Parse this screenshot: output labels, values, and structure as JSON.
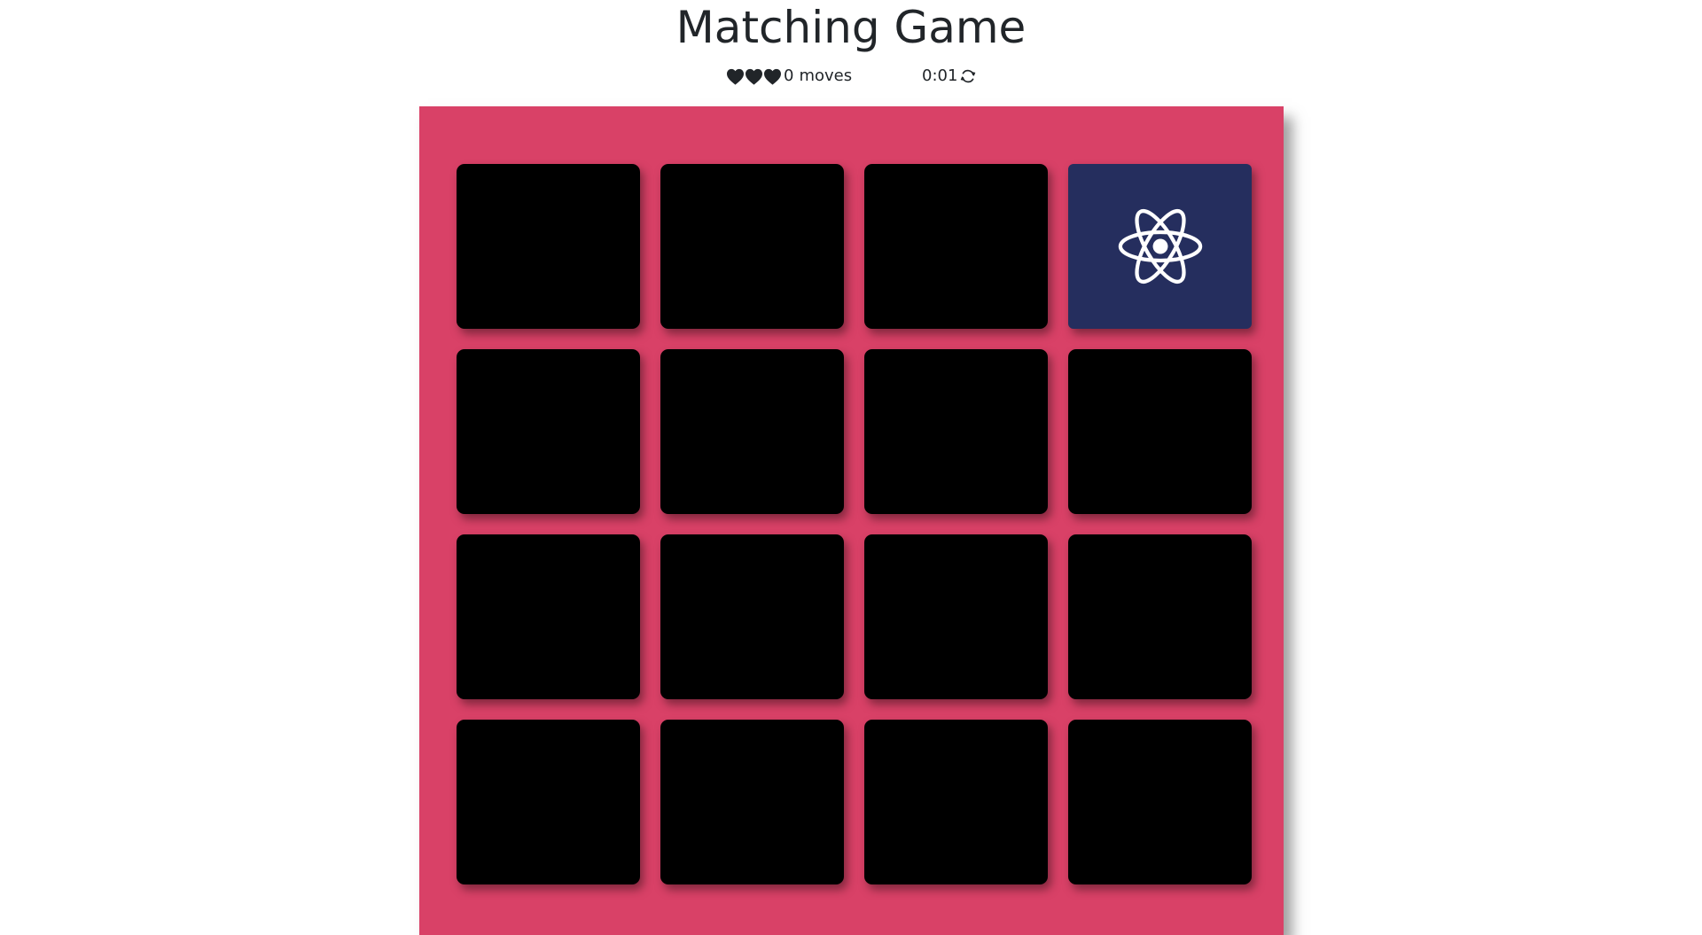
{
  "game": {
    "title": "Matching Game",
    "moves_count": "0",
    "moves_label": "moves",
    "timer": "0:01",
    "stars_total": 3,
    "stars_filled": 3,
    "icons": {
      "stars": "heart-icon",
      "restart": "refresh-icon",
      "open_card": "react-atom-icon"
    },
    "colors": {
      "board": "#d94167",
      "card_back": "#000000",
      "card_open": "#252e5e",
      "icon_light": "#ffffff"
    }
  },
  "board": {
    "rows": 4,
    "columns": 4,
    "cards": [
      {
        "state": "closed"
      },
      {
        "state": "closed"
      },
      {
        "state": "closed"
      },
      {
        "state": "open",
        "icon": "react-atom-icon"
      },
      {
        "state": "closed"
      },
      {
        "state": "closed"
      },
      {
        "state": "closed"
      },
      {
        "state": "closed"
      },
      {
        "state": "closed"
      },
      {
        "state": "closed"
      },
      {
        "state": "closed"
      },
      {
        "state": "closed"
      },
      {
        "state": "closed"
      },
      {
        "state": "closed"
      },
      {
        "state": "closed"
      },
      {
        "state": "closed"
      }
    ]
  }
}
